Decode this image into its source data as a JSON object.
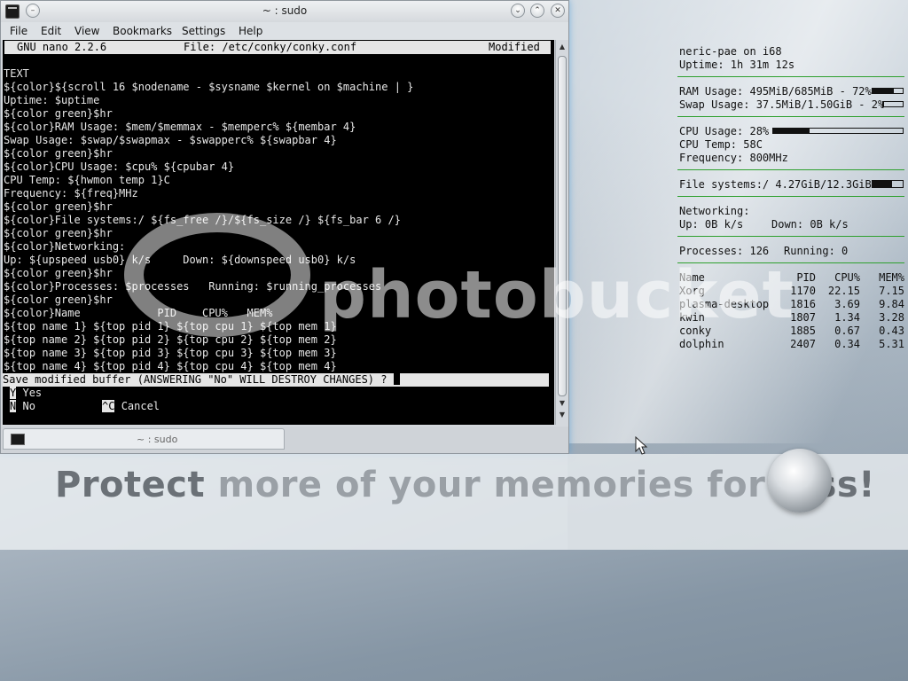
{
  "window": {
    "title": "~ : sudo",
    "menu": [
      "File",
      "Edit",
      "View",
      "Bookmarks",
      "Settings",
      "Help"
    ],
    "tab_label": "~ : sudo"
  },
  "nano": {
    "version": "GNU nano 2.2.6",
    "file": "File: /etc/conky/conky.conf",
    "status": "Modified",
    "lines": [
      "",
      "TEXT",
      "${color}${scroll 16 $nodename - $sysname $kernel on $machine | }",
      "Uptime: $uptime",
      "${color green}$hr",
      "${color}RAM Usage: $mem/$memmax - $memperc% ${membar 4}",
      "Swap Usage: $swap/$swapmax - $swapperc% ${swapbar 4}",
      "${color green}$hr",
      "${color}CPU Usage: $cpu% ${cpubar 4}",
      "CPU Temp: ${hwmon temp 1}C",
      "Frequency: ${freq}MHz",
      "${color green}$hr",
      "${color}File systems:/ ${fs_free /}/${fs_size /} ${fs_bar 6 /}",
      "${color green}$hr",
      "${color}Networking:",
      "Up: ${upspeed usb0} k/s     Down: ${downspeed usb0} k/s",
      "${color green}$hr",
      "${color}Processes: $processes   Running: $running_processes",
      "${color green}$hr",
      "${color}Name            PID    CPU%   MEM%",
      "${top name 1} ${top pid 1} ${top cpu 1} ${top mem 1}",
      "${top name 2} ${top pid 2} ${top cpu 2} ${top mem 2}",
      "${top name 3} ${top pid 3} ${top cpu 3} ${top mem 3}",
      "${top name 4} ${top pid 4} ${top cpu 4} ${top mem 4}"
    ],
    "prompt": "Save modified buffer (ANSWERING \"No\" WILL DESTROY CHANGES) ? ",
    "opt_yes_key": "Y",
    "opt_yes": "Yes",
    "opt_no_key": "N",
    "opt_no": "No",
    "opt_cancel_key": "^C",
    "opt_cancel": "Cancel"
  },
  "conky": {
    "host": "neric-pae on i68",
    "uptime": "Uptime: 1h 31m 12s",
    "ram": "RAM Usage: 495MiB/685MiB - 72%",
    "ram_pct": 72,
    "swap": "Swap Usage: 37.5MiB/1.50GiB - 2%",
    "swap_pct": 2,
    "cpu": "CPU Usage: 28%",
    "cpu_pct": 28,
    "temp": "CPU Temp: 58C",
    "freq": "Frequency: 800MHz",
    "fs": "File systems:/ 4.27GiB/12.3GiB",
    "fs_pct": 65,
    "net_title": "Networking:",
    "net_up": "Up: 0B k/s",
    "net_down": "Down: 0B k/s",
    "procs": "Processes: 126",
    "running": "Running: 0",
    "proc_headers": [
      "Name",
      "PID",
      "CPU%",
      "MEM%"
    ],
    "proc_rows": [
      [
        "Xorg",
        "1170",
        "22.15",
        "7.15"
      ],
      [
        "plasma-desktop",
        "1816",
        "3.69",
        "9.84"
      ],
      [
        "kwin",
        "1807",
        "1.34",
        "3.28"
      ],
      [
        "conky",
        "1885",
        "0.67",
        "0.43"
      ],
      [
        "dolphin",
        "2407",
        "0.34",
        "5.31"
      ]
    ]
  },
  "watermark": {
    "logo": "photobucket",
    "tagline_a": "Protect",
    "tagline_b": " more of your memories for ",
    "tagline_c": "less!"
  },
  "colors": {
    "accent_green": "#2ea02e",
    "terminal_bg": "#000000"
  }
}
